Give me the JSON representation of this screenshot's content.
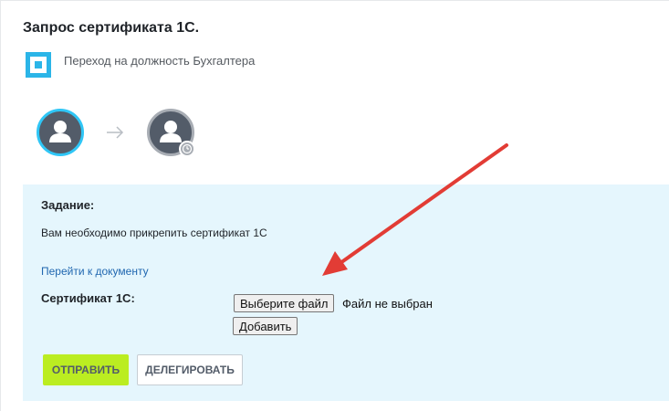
{
  "header": {
    "title": "Запрос сертификата 1С.",
    "process_name": "Переход на должность Бухгалтера",
    "process_icon": "workflow-square-icon"
  },
  "participants": {
    "current_icon": "user-avatar-icon",
    "next_icon": "user-avatar-icon",
    "next_status_icon": "clock-icon",
    "arrow_icon": "arrow-right-icon"
  },
  "task": {
    "heading": "Задание:",
    "text": "Вам необходимо прикрепить сертификат 1С",
    "document_link": "Перейти к документу",
    "field_label": "Сертификат 1С:",
    "choose_file_label": "Выберите файл",
    "no_file_text": "Файл не выбран",
    "add_label": "Добавить",
    "send_label": "ОТПРАВИТЬ",
    "delegate_label": "ДЕЛЕГИРОВАТЬ"
  },
  "colors": {
    "accent_blue": "#2bb5e8",
    "panel_background": "#e5f6fd",
    "send_button": "#bbed21",
    "link": "#2067b0",
    "annotation_arrow": "#e23c35"
  }
}
